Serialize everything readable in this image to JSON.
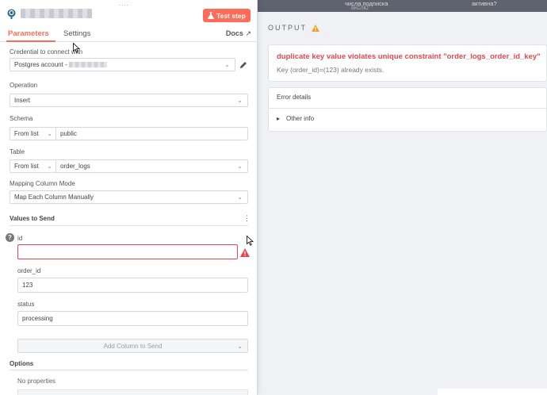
{
  "canvas_bg": {
    "left_text": "числа подписка",
    "left_sub": "ВКСЛЮ",
    "right_text": "активна?"
  },
  "panel": {
    "drag_handle": "....",
    "test_button_label": "Test step",
    "tabs": [
      {
        "label": "Parameters",
        "active": true
      },
      {
        "label": "Settings",
        "active": false
      }
    ],
    "docs_label": "Docs"
  },
  "credential": {
    "label": "Credential to connect with",
    "value": "Postgres account -"
  },
  "operation": {
    "label": "Operation",
    "value": "Insert"
  },
  "schema": {
    "label": "Schema",
    "mode": "From list",
    "value": "public"
  },
  "table": {
    "label": "Table",
    "mode": "From list",
    "value": "order_logs"
  },
  "mapping": {
    "label": "Mapping Column Mode",
    "value": "Map Each Column Manually"
  },
  "values_to_send": {
    "title": "Values to Send",
    "fields": [
      {
        "label": "id",
        "value": "",
        "error": true
      },
      {
        "label": "order_id",
        "value": "123",
        "error": false
      },
      {
        "label": "status",
        "value": "processing",
        "error": false
      }
    ],
    "add_column_label": "Add Column to Send"
  },
  "options": {
    "title": "Options",
    "empty_text": "No properties"
  },
  "output": {
    "title": "OUTPUT",
    "error_title": "duplicate key value violates unique constraint \"order_logs_order_id_key\"",
    "error_desc": "Key (order_id)=(123) already exists.",
    "details_title": "Error details",
    "other_info_label": "Other info"
  },
  "colors": {
    "accent": "#ff6d5a",
    "error": "#e5484d",
    "warning": "#f0a020"
  }
}
